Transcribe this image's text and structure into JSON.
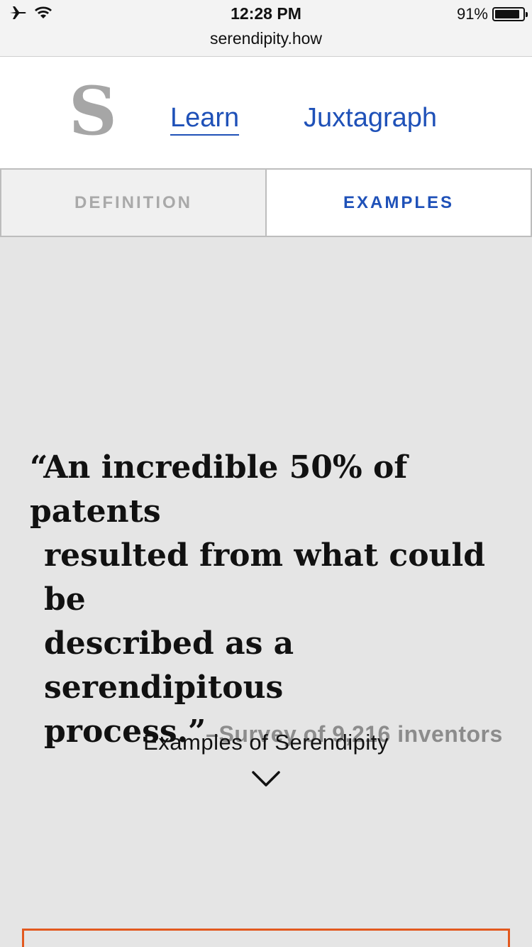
{
  "status_bar": {
    "time": "12:28 PM",
    "battery_percent": "91%",
    "battery_level": 0.91,
    "url": "serendipity.how",
    "icons": [
      "airplane-icon",
      "wifi-icon",
      "battery-icon"
    ]
  },
  "header": {
    "logo": "S",
    "nav": [
      {
        "label": "Learn",
        "active": true
      },
      {
        "label": "Juxtagraph",
        "active": false
      }
    ]
  },
  "tabs": [
    {
      "label": "DEFINITION",
      "active": false
    },
    {
      "label": "EXAMPLES",
      "active": true
    }
  ],
  "quote": {
    "lines": [
      "“An incredible 50% of patents",
      "resulted from what could be",
      "described as a serendipitous",
      "process.”"
    ],
    "attribution": "–Survey of 9,216 inventors"
  },
  "examples": {
    "label": "Examples of Serendipity",
    "icon": "chevron-down-icon"
  },
  "colors": {
    "accent": "#1f51b8",
    "muted": "#a6a6a6",
    "background": "#e5e5e5",
    "card_border": "#e2591f"
  }
}
